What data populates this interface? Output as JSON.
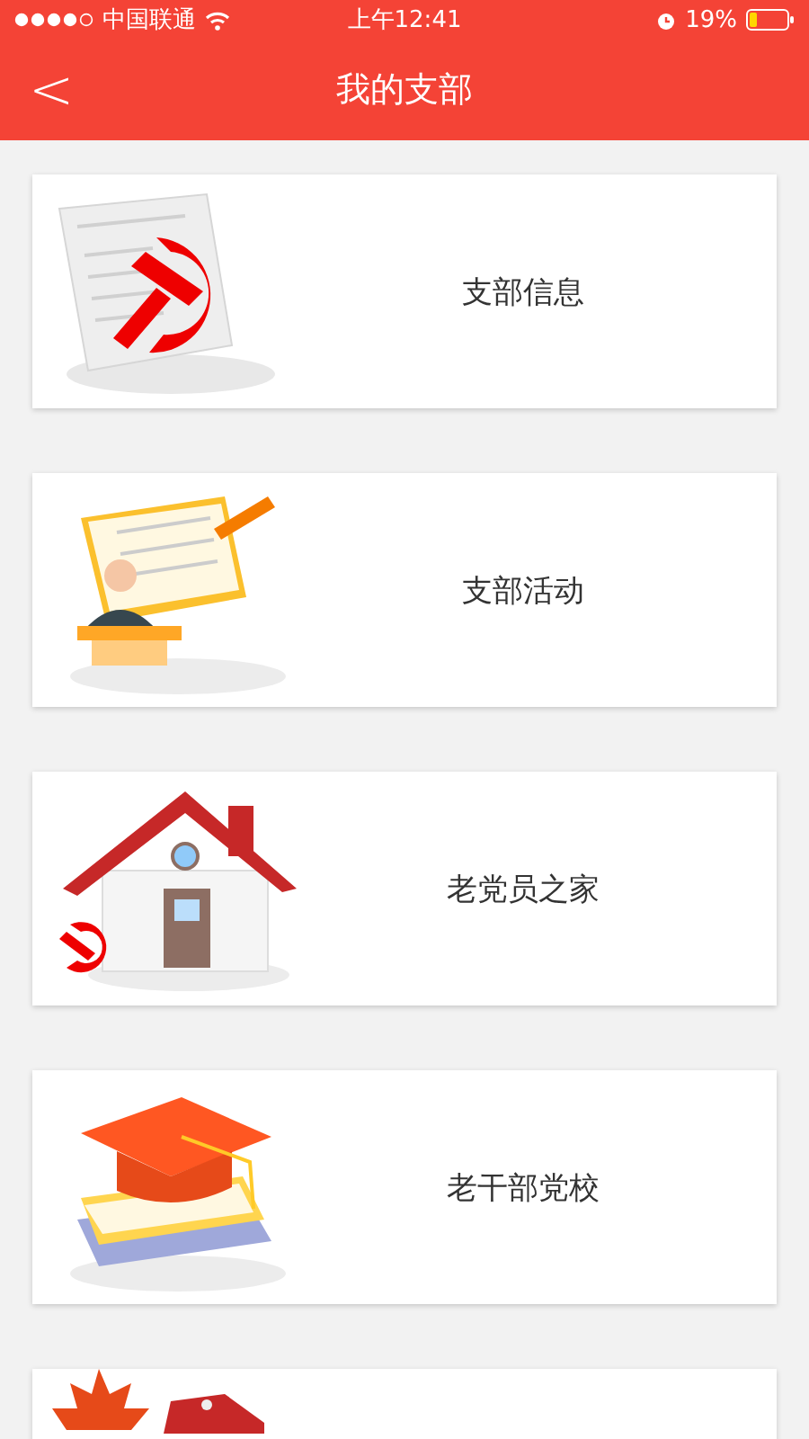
{
  "status_bar": {
    "carrier": "中国联通",
    "time": "上午12:41",
    "battery": "19%"
  },
  "nav": {
    "back": "<",
    "title": "我的支部"
  },
  "cards": [
    {
      "label": "支部信息"
    },
    {
      "label": "支部活动"
    },
    {
      "label": "老党员之家"
    },
    {
      "label": "老干部党校"
    }
  ]
}
